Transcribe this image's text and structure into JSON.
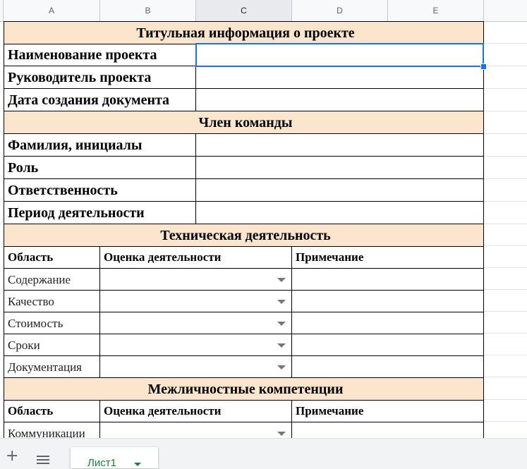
{
  "columns": [
    "A",
    "B",
    "C",
    "D",
    "E"
  ],
  "sections": {
    "title_info": {
      "header": "Титульная информация о проекте",
      "rows": [
        "Наименование проекта",
        "Руководитель проекта",
        "Дата создания документа"
      ]
    },
    "team_member": {
      "header": "Член команды",
      "rows": [
        "Фамилия, инициалы",
        "Роль",
        "Ответственность",
        "Период деятельности"
      ]
    },
    "tech_activity": {
      "header": "Техническая деятельность",
      "col_area": "Область",
      "col_rating": "Оценка деятельности",
      "col_note": "Примечание",
      "rows": [
        "Содержание",
        "Качество",
        "Стоимость",
        "Сроки",
        "Документация"
      ]
    },
    "interpersonal": {
      "header": "Межличностные компетенции",
      "col_area": "Область",
      "col_rating": "Оценка деятельности",
      "col_note": "Примечание",
      "rows": [
        "Коммуникации"
      ]
    }
  },
  "sheet_tab": "Лист1",
  "colors": {
    "header_fill": "#fce5cd",
    "selection": "#1a73e8",
    "tab_text": "#188038"
  }
}
